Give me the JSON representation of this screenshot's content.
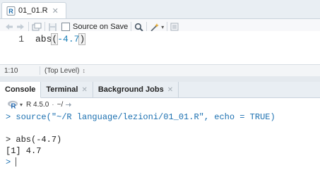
{
  "source_tab": {
    "file_name": "01_01.R"
  },
  "editor_toolbar": {
    "source_on_save_label": "Source on Save"
  },
  "editor": {
    "line_number": "1",
    "code_prefix": "abs",
    "paren_open": "(",
    "code_arg": "-4.7",
    "paren_close": ")"
  },
  "status_bar": {
    "cursor_position": "1:10",
    "scope": "(Top Level)",
    "scope_arrow": "↕"
  },
  "console_tabs": [
    {
      "label": "Console",
      "closable": false
    },
    {
      "label": "Terminal",
      "closable": true
    },
    {
      "label": "Background Jobs",
      "closable": true
    }
  ],
  "console_toolbar": {
    "r_version": "R 4.5.0",
    "separator": "·",
    "working_dir": "~/"
  },
  "console": {
    "prompt": ">",
    "source_cmd": "source(\"~/R language/lezioni/01_01.R\", echo = TRUE)",
    "echo_cmd": "abs(-4.7)",
    "output": "[1] 4.7"
  },
  "colors": {
    "accent": "#1a6fb0",
    "tab_bar": "#e9eef3",
    "number": "#1a7fb8"
  }
}
